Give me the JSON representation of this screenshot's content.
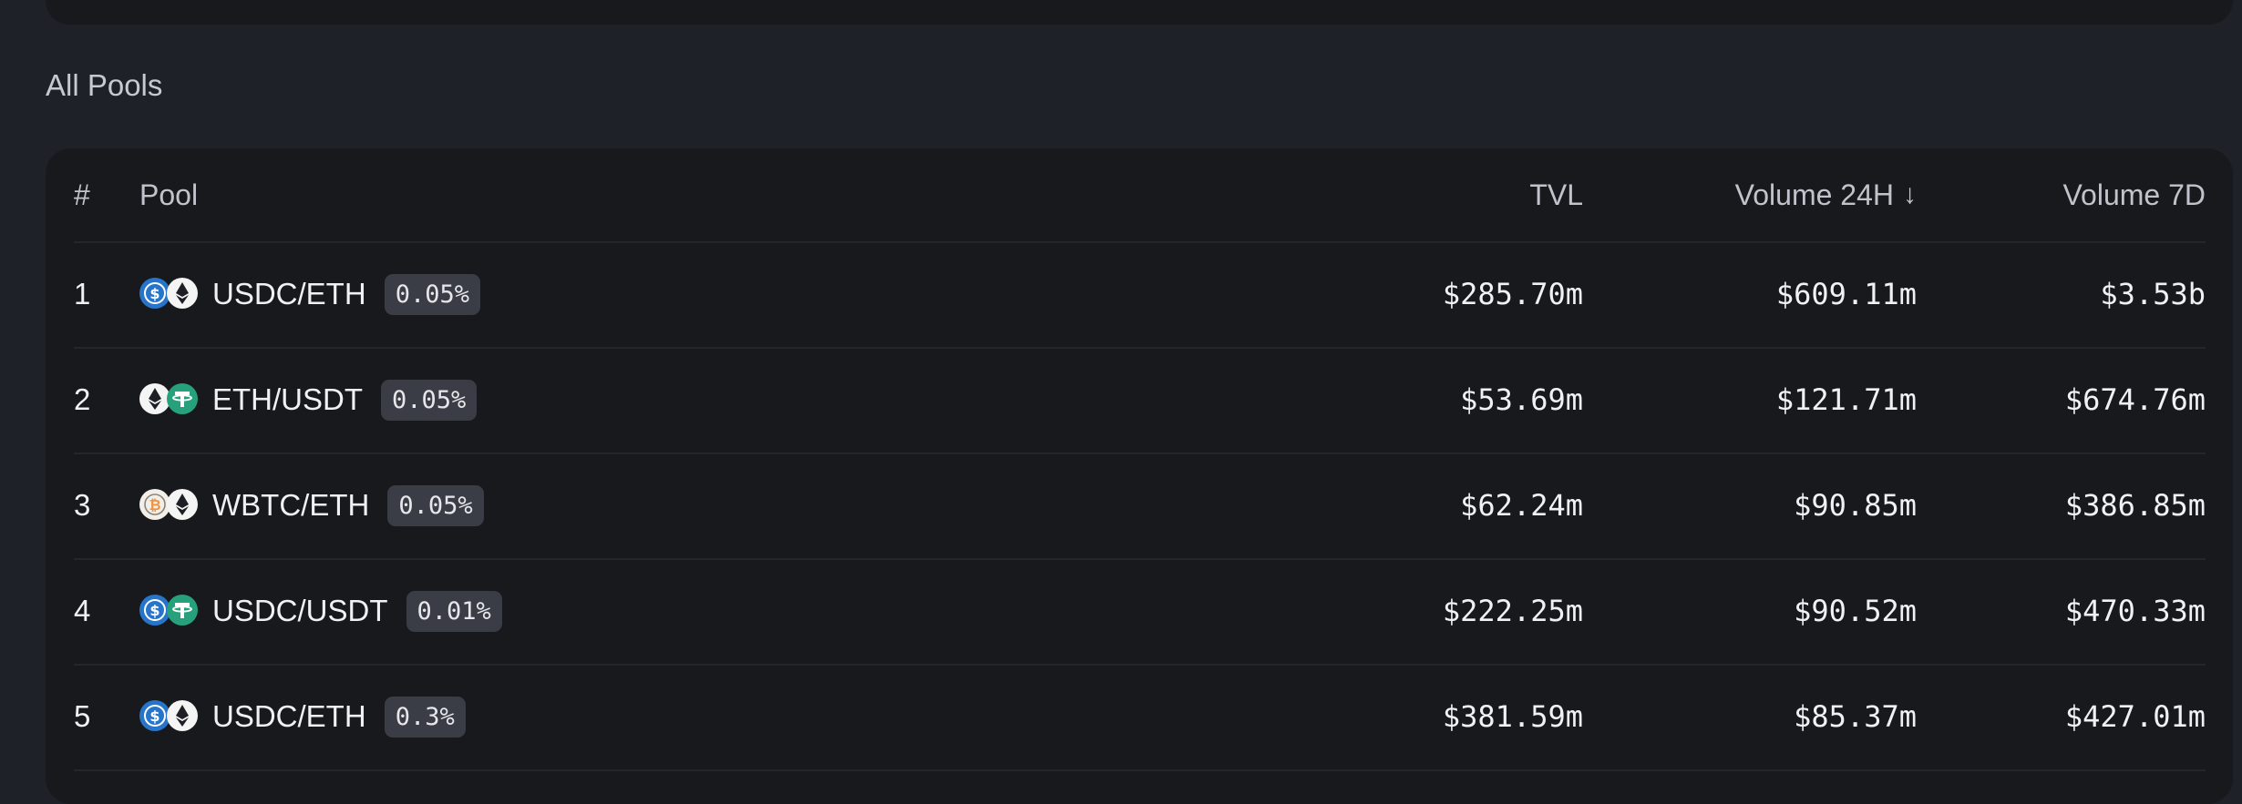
{
  "section_title": "All Pools",
  "table": {
    "headers": {
      "rank": "#",
      "pool": "Pool",
      "tvl": "TVL",
      "volume_24h": "Volume 24H",
      "volume_24h_sort_icon": "arrow-down-icon",
      "volume_7d": "Volume 7D"
    },
    "rows": [
      {
        "rank": "1",
        "token_a": "usdc",
        "token_b": "eth",
        "pair": "USDC/ETH",
        "fee": "0.05%",
        "tvl": "$285.70m",
        "volume_24h": "$609.11m",
        "volume_7d": "$3.53b"
      },
      {
        "rank": "2",
        "token_a": "eth",
        "token_b": "usdt",
        "pair": "ETH/USDT",
        "fee": "0.05%",
        "tvl": "$53.69m",
        "volume_24h": "$121.71m",
        "volume_7d": "$674.76m"
      },
      {
        "rank": "3",
        "token_a": "wbtc",
        "token_b": "eth",
        "pair": "WBTC/ETH",
        "fee": "0.05%",
        "tvl": "$62.24m",
        "volume_24h": "$90.85m",
        "volume_7d": "$386.85m"
      },
      {
        "rank": "4",
        "token_a": "usdc",
        "token_b": "usdt",
        "pair": "USDC/USDT",
        "fee": "0.01%",
        "tvl": "$222.25m",
        "volume_24h": "$90.52m",
        "volume_7d": "$470.33m"
      },
      {
        "rank": "5",
        "token_a": "usdc",
        "token_b": "eth",
        "pair": "USDC/ETH",
        "fee": "0.3%",
        "tvl": "$381.59m",
        "volume_24h": "$85.37m",
        "volume_7d": "$427.01m"
      }
    ]
  },
  "colors": {
    "background": "#1f2128",
    "card": "#18191d",
    "fee_badge": "#3a3d46",
    "usdc": "#2775ca",
    "usdt": "#26a17b",
    "wbtc": "#f09242"
  }
}
